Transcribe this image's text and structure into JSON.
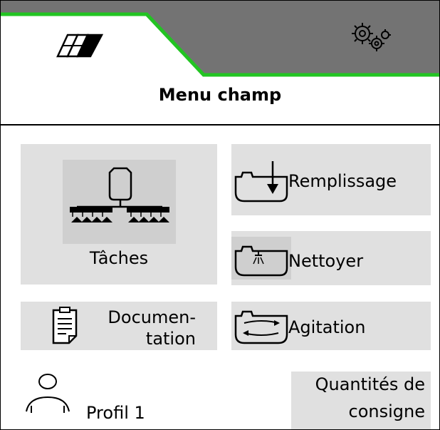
{
  "header": {
    "tabs": [
      {
        "id": "field-menu",
        "icon": "field-icon",
        "active": true
      },
      {
        "id": "settings-menu",
        "icon": "gears-icon",
        "active": false
      }
    ],
    "title": "Menu champ"
  },
  "tiles": {
    "taches": {
      "label": "Tâches",
      "icon": "sprayer-icon"
    },
    "remplissage": {
      "label": "Remplissage",
      "icon": "tank-fill-icon"
    },
    "nettoyer": {
      "label": "Nettoyer",
      "icon": "tank-clean-icon"
    },
    "documentation": {
      "label_line1": "Documen-",
      "label_line2": "tation",
      "icon": "document-icon"
    },
    "agitation": {
      "label": "Agitation",
      "icon": "tank-agitation-icon"
    },
    "quantites": {
      "label_line1": "Quantités de",
      "label_line2": "consigne"
    }
  },
  "profile": {
    "label": "Profil 1",
    "icon": "user-icon"
  },
  "colors": {
    "tab_inactive": "#737373",
    "accent": "#22c422",
    "tile": "#e0e0e0",
    "icon_box": "#cfcfcf"
  }
}
